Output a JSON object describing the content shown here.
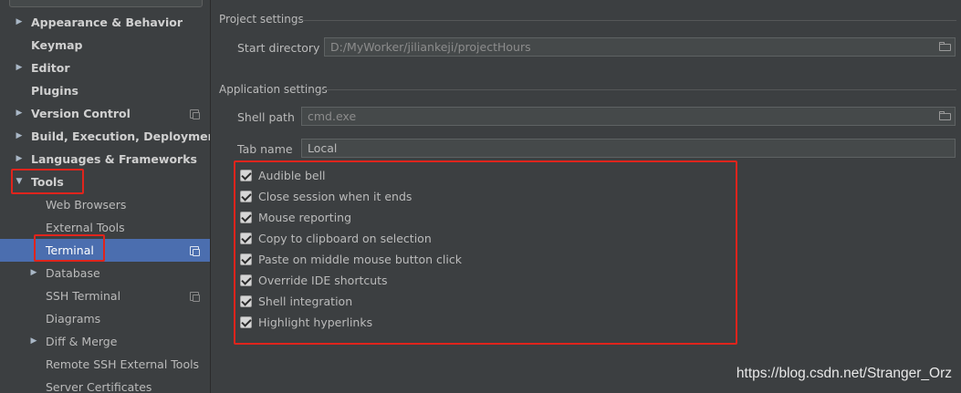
{
  "sidebar": {
    "items": [
      {
        "label": "Appearance & Behavior",
        "bold": true,
        "arrow": "▶",
        "indent": 0,
        "icon": ""
      },
      {
        "label": "Keymap",
        "bold": true,
        "arrow": "",
        "indent": 0,
        "icon": ""
      },
      {
        "label": "Editor",
        "bold": true,
        "arrow": "▶",
        "indent": 0,
        "icon": ""
      },
      {
        "label": "Plugins",
        "bold": true,
        "arrow": "",
        "indent": 0,
        "icon": ""
      },
      {
        "label": "Version Control",
        "bold": true,
        "arrow": "▶",
        "indent": 0,
        "icon": "project-scope-icon"
      },
      {
        "label": "Build, Execution, Deployment",
        "bold": true,
        "arrow": "▶",
        "indent": 0,
        "icon": ""
      },
      {
        "label": "Languages & Frameworks",
        "bold": true,
        "arrow": "▶",
        "indent": 0,
        "icon": ""
      },
      {
        "label": "Tools",
        "bold": true,
        "arrow": "▼",
        "indent": 0,
        "icon": ""
      },
      {
        "label": "Web Browsers",
        "bold": false,
        "arrow": "",
        "indent": 1,
        "icon": ""
      },
      {
        "label": "External Tools",
        "bold": false,
        "arrow": "",
        "indent": 1,
        "icon": ""
      },
      {
        "label": "Terminal",
        "bold": false,
        "arrow": "",
        "indent": 1,
        "icon": "project-scope-icon",
        "selected": true
      },
      {
        "label": "Database",
        "bold": false,
        "arrow": "▶",
        "indent": 1,
        "icon": ""
      },
      {
        "label": "SSH Terminal",
        "bold": false,
        "arrow": "",
        "indent": 1,
        "icon": "project-scope-icon"
      },
      {
        "label": "Diagrams",
        "bold": false,
        "arrow": "",
        "indent": 1,
        "icon": ""
      },
      {
        "label": "Diff & Merge",
        "bold": false,
        "arrow": "▶",
        "indent": 1,
        "icon": ""
      },
      {
        "label": "Remote SSH External Tools",
        "bold": false,
        "arrow": "",
        "indent": 1,
        "icon": ""
      },
      {
        "label": "Server Certificates",
        "bold": false,
        "arrow": "",
        "indent": 1,
        "icon": ""
      }
    ]
  },
  "project_settings": {
    "title": "Project settings",
    "start_directory_label": "Start directory",
    "start_directory_value": "D:/MyWorker/jiliankeji/projectHours",
    "browse_icon": "folder-icon"
  },
  "application_settings": {
    "title": "Application settings",
    "shell_path_label": "Shell path",
    "shell_path_value": "cmd.exe",
    "browse_icon": "folder-icon",
    "tab_name_label": "Tab name",
    "tab_name_value": "Local",
    "options": [
      {
        "label": "Audible bell",
        "checked": true
      },
      {
        "label": "Close session when it ends",
        "checked": true
      },
      {
        "label": "Mouse reporting",
        "checked": true
      },
      {
        "label": "Copy to clipboard on selection",
        "checked": true
      },
      {
        "label": "Paste on middle mouse button click",
        "checked": true
      },
      {
        "label": "Override IDE shortcuts",
        "checked": true
      },
      {
        "label": "Shell integration",
        "checked": true
      },
      {
        "label": "Highlight hyperlinks",
        "checked": true
      }
    ]
  },
  "watermark": "https://blog.csdn.net/Stranger_Orz",
  "colors": {
    "background": "#3c3f41",
    "selection": "#4b6eaf",
    "annotation": "#e0241c",
    "text": "#bbbbbb"
  }
}
